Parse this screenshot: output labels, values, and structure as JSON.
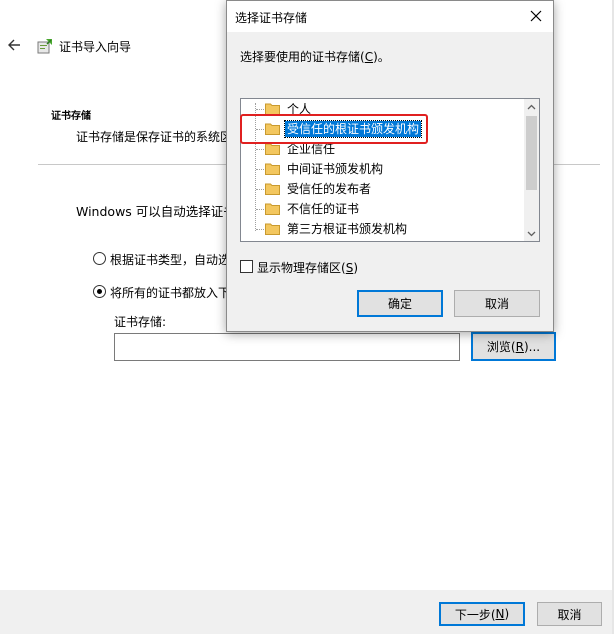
{
  "wizard": {
    "title": "证书导入向导",
    "section_title": "证书存储",
    "section_desc": "证书存储是保存证书的系统区",
    "windows_desc": "Windows 可以自动选择证书",
    "radio_auto_label": "根据证书类型，自动选",
    "radio_manual_label": "将所有的证书都放入下",
    "store_label": "证书存储:",
    "store_value": "",
    "browse_button": {
      "prefix": "浏览(",
      "accel": "R",
      "suffix": ")..."
    },
    "next_button": {
      "prefix": "下一步(",
      "accel": "N",
      "suffix": ")"
    },
    "cancel_button": "取消",
    "radio_selected": "manual"
  },
  "dialog": {
    "title": "选择证书存储",
    "prompt": {
      "prefix": "选择要使用的证书存储(",
      "accel": "C",
      "suffix": ")。"
    },
    "stores": [
      {
        "label": "个人",
        "selected": false
      },
      {
        "label": "受信任的根证书颁发机构",
        "selected": true
      },
      {
        "label": "企业信任",
        "selected": false
      },
      {
        "label": "中间证书颁发机构",
        "selected": false
      },
      {
        "label": "受信任的发布者",
        "selected": false
      },
      {
        "label": "不信任的证书",
        "selected": false
      },
      {
        "label": "第三方根证书颁发机构",
        "selected": false
      }
    ],
    "show_physical": {
      "prefix": "显示物理存储区(",
      "accel": "S",
      "suffix": ")",
      "checked": false
    },
    "ok_button": "确定",
    "cancel_button": "取消"
  },
  "colors": {
    "selection": "#0078d7",
    "annotation_highlight": "#e02020",
    "folder": "#f3c75f"
  },
  "icons": [
    "back-arrow-icon",
    "certificate-wizard-icon",
    "close-icon",
    "folder-icon",
    "scroll-up-icon",
    "scroll-down-icon"
  ]
}
